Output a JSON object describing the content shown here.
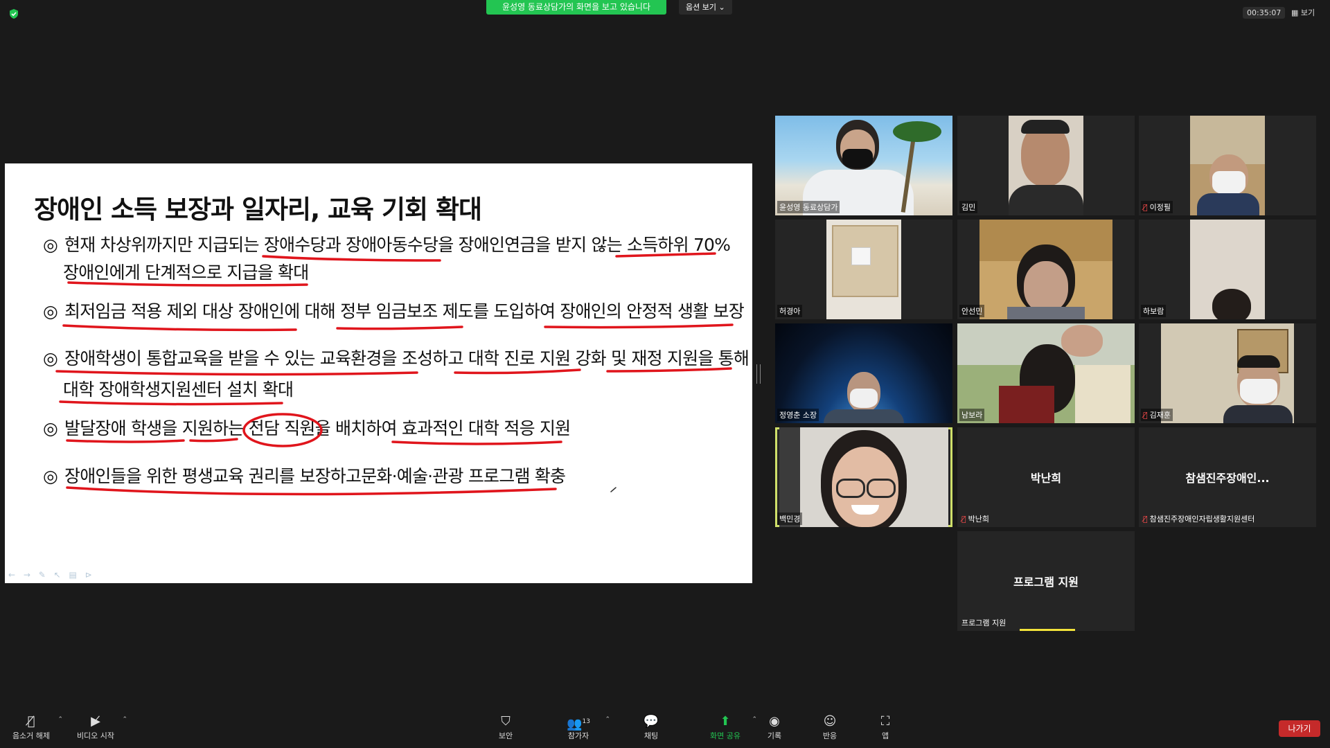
{
  "top": {
    "share_banner": "윤성영 동료상담가의 화면을 보고 있습니다",
    "view_options": "옵션 보기 ⌄",
    "timer": "00:35:07",
    "view_toggle": "보기"
  },
  "slide": {
    "title": "장애인 소득 보장과 일자리, 교육 기회 확대",
    "bullet_mark": "◎",
    "bullets": [
      {
        "line1": "현재 차상위까지만 지급되는 장애수당과 장애아동수당을 장애인연금을 받지 않는 소득하위 70%",
        "line2": "장애인에게 단계적으로 지급을 확대"
      },
      {
        "line1": "최저임금 적용 제외 대상 장애인에 대해 정부 임금보조 제도를 도입하여 장애인의 안정적 생활 보장"
      },
      {
        "line1": "장애학생이 통합교육을 받을 수 있는 교육환경을 조성하고 대학 진로 지원 강화 및 재정 지원을 통해",
        "line2": "대학 장애학생지원센터 설치 확대"
      },
      {
        "line1": "발달장애 학생을 지원하는 전담 직원을 배치하여 효과적인 대학 적응 지원"
      },
      {
        "line1": "장애인들을 위한 평생교육 권리를 보장하고문화·예술·관광 프로그램 확충"
      }
    ],
    "annotation_color": "#e0151c",
    "tools": "← → ✎ ↖ ▤ ⊳"
  },
  "participants": [
    {
      "name": "윤성영 동료상담가",
      "muted": false
    },
    {
      "name": "김민",
      "muted": false
    },
    {
      "name": "이정필",
      "muted": true
    },
    {
      "name": "허경아",
      "muted": false
    },
    {
      "name": "안선민",
      "muted": false
    },
    {
      "name": "하보람",
      "muted": false
    },
    {
      "name": "정영춘 소장",
      "muted": false
    },
    {
      "name": "남보라",
      "muted": false
    },
    {
      "name": "김재훈",
      "muted": true
    },
    {
      "name": "백민경",
      "muted": false,
      "active_speaker": true
    },
    {
      "name": "박난희",
      "display": "박난희",
      "muted": true
    },
    {
      "name": "참샘진주장애인자립생활지원센터",
      "display": "참샘진주장애인...",
      "muted": true
    },
    {
      "name": "프로그램 지원",
      "display": "프로그램 지원",
      "muted": false
    }
  ],
  "active_speaker_color": "#cfe06a",
  "toolbar": {
    "mute": "음소거 해제",
    "video": "비디오 시작",
    "security": "보안",
    "participants": "참가자",
    "participants_count": "13",
    "chat": "채팅",
    "share": "화면 공유",
    "record": "기록",
    "reactions": "반응",
    "apps": "앱",
    "leave": "나가기"
  }
}
